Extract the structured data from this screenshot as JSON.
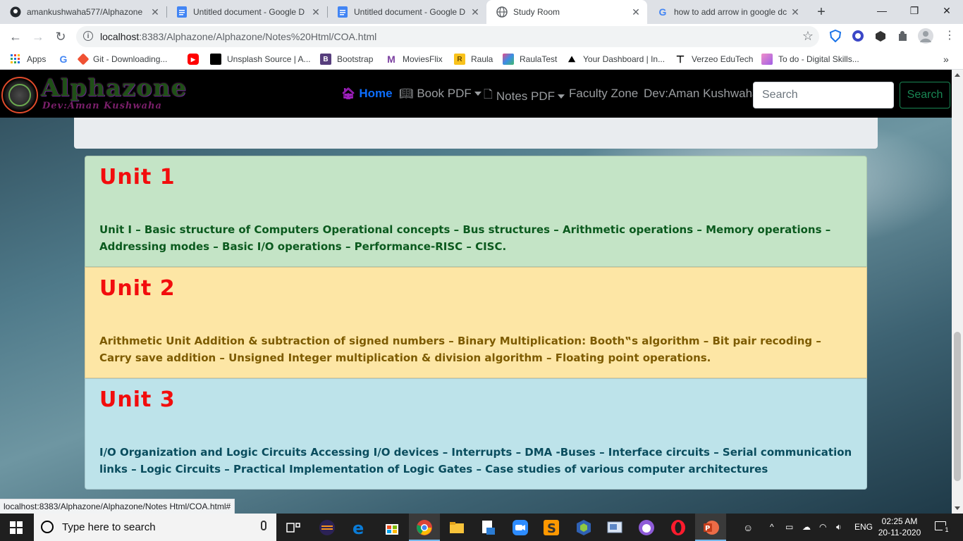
{
  "browser": {
    "tabs": [
      {
        "title": "amankushwaha577/Alphazone",
        "icon": "github-icon",
        "active": false
      },
      {
        "title": "Untitled document - Google D",
        "icon": "google-docs-icon",
        "active": false
      },
      {
        "title": "Untitled document - Google D",
        "icon": "google-docs-icon",
        "active": false
      },
      {
        "title": "Study Room",
        "icon": "globe-icon",
        "active": true
      },
      {
        "title": "how to add arrow in google dc",
        "icon": "google-icon",
        "active": false
      }
    ],
    "new_tab": "+",
    "window_controls": {
      "minimize": "—",
      "maximize": "❐",
      "close": "✕"
    },
    "address": {
      "host": "localhost",
      "rest": ":8383/Alphazone/Alphazone/Notes%20Html/COA.html"
    },
    "bookmarks": [
      {
        "label": "Apps",
        "icon": "apps-grid-icon"
      },
      {
        "label": "",
        "icon": "google-icon"
      },
      {
        "label": "Git - Downloading...",
        "icon": "git-icon"
      },
      {
        "label": "",
        "icon": "youtube-icon"
      },
      {
        "label": "Unsplash Source | A...",
        "icon": "unsplash-icon"
      },
      {
        "label": "Bootstrap",
        "icon": "bootstrap-icon"
      },
      {
        "label": "MoviesFlix",
        "icon": "moviesflix-icon"
      },
      {
        "label": "Raula",
        "icon": "raula-icon"
      },
      {
        "label": "RaulaTest",
        "icon": "raulatest-icon"
      },
      {
        "label": "Your Dashboard | In...",
        "icon": "dashboard-icon"
      },
      {
        "label": "Verzeo EduTech",
        "icon": "verzeo-icon"
      },
      {
        "label": "To do - Digital Skills...",
        "icon": "todo-icon"
      }
    ],
    "more_bookmarks": "»",
    "status_url": "localhost:8383/Alphazone/Alphazone/Notes Html/COA.html#"
  },
  "site": {
    "brand": "Alphazone",
    "brand_sub": "Dev:Aman Kushwaha",
    "nav": {
      "home": "Home",
      "book_pdf": "Book PDF",
      "notes_pdf": "Notes PDF",
      "faculty_zone": "Faculty Zone",
      "dev": "Dev:Aman Kushwaha"
    },
    "search": {
      "placeholder": "Search",
      "button": "Search"
    },
    "colors": {
      "unit1": "#c4e4c6",
      "unit2": "#fde6a5",
      "unit3": "#bde3ea",
      "heading": "#f20d0d"
    }
  },
  "units": [
    {
      "title": "Unit 1",
      "text": "Unit I – Basic structure of Computers Operational concepts – Bus structures – Arithmetic operations – Memory operations – Addressing modes – Basic I/O operations – Performance-RISC – CISC."
    },
    {
      "title": "Unit 2",
      "text": "Arithmetic Unit Addition & subtraction of signed numbers – Binary Multiplication: Booth‟s algorithm – Bit pair recoding – Carry save addition – Unsigned Integer multiplication & division algorithm – Floating point operations."
    },
    {
      "title": "Unit 3",
      "text": "I/O Organization and Logic Circuits Accessing I/O devices – Interrupts – DMA -Buses – Interface circuits – Serial communication links – Logic Circuits – Practical Implementation of Logic Gates – Case studies of various computer architectures"
    }
  ],
  "taskbar": {
    "search_placeholder": "Type here to search",
    "language": "ENG",
    "time": "02:25 AM",
    "date": "20-11-2020",
    "notifications": "1"
  }
}
